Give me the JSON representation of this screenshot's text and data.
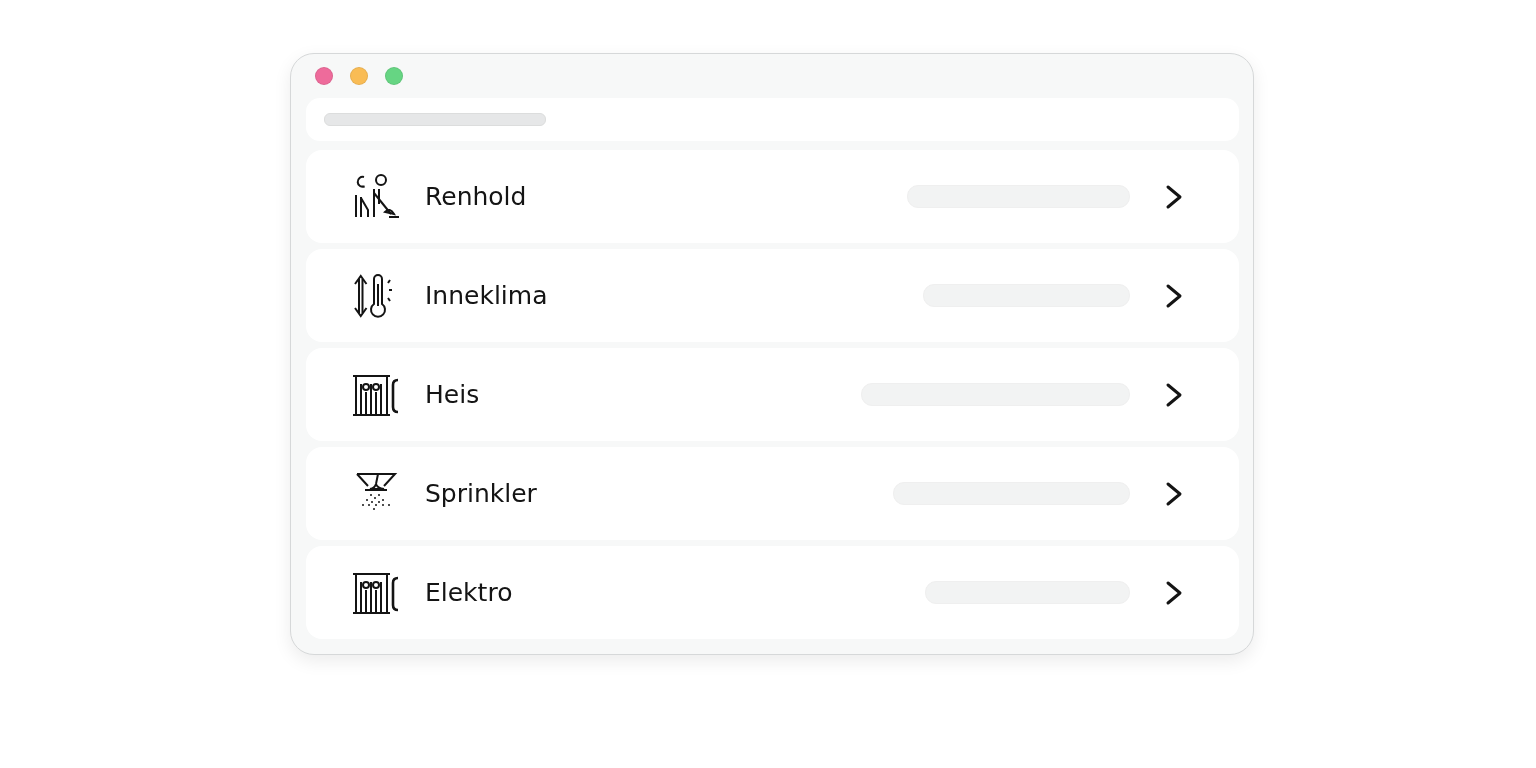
{
  "window": {
    "controls": [
      {
        "color": "#ee6b9b"
      },
      {
        "color": "#f9bc55"
      },
      {
        "color": "#66d583"
      }
    ]
  },
  "list": {
    "items": [
      {
        "kind": "cleaning",
        "label": "Renhold"
      },
      {
        "kind": "climate",
        "label": "Inneklima"
      },
      {
        "kind": "elevator",
        "label": "Heis"
      },
      {
        "kind": "sprinkler",
        "label": "Sprinkler"
      },
      {
        "kind": "elevator",
        "label": "Elektro"
      }
    ]
  }
}
